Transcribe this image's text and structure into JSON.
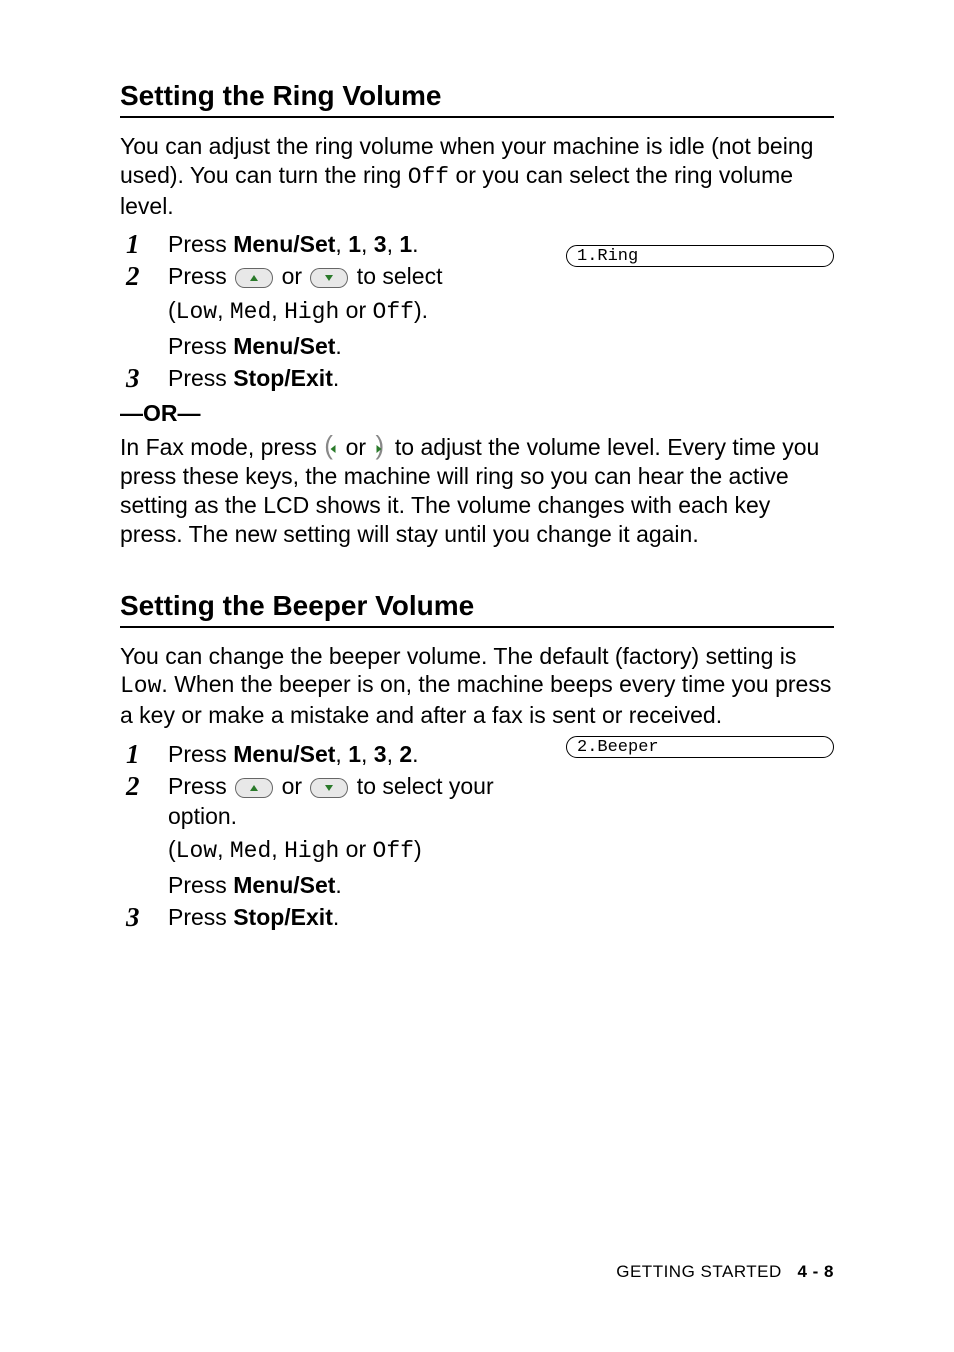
{
  "section1": {
    "title": "Setting the Ring Volume",
    "intro_pre": "You can adjust the ring volume when your machine is idle (not being used). You can turn the ring ",
    "intro_mono": "Off",
    "intro_post": " or you can select the ring volume level.",
    "lcd": "1.Ring",
    "steps": {
      "1": {
        "num": "1",
        "pre": "Press ",
        "bold": "Menu/Set",
        "post": ", ",
        "b1": "1",
        "c1": ", ",
        "b2": "3",
        "c2": ", ",
        "b3": "1",
        "end": "."
      },
      "2": {
        "num": "2",
        "pre": "Press ",
        "mid_or": " or ",
        "post": " to select",
        "line2_open": "(",
        "opt1": "Low",
        "sep1": ", ",
        "opt2": "Med",
        "sep2": ", ",
        "opt3": "High",
        "sep_or": " or ",
        "opt4": "Off",
        "line2_close": ").",
        "line3_pre": "Press ",
        "line3_bold": "Menu/Set",
        "line3_end": "."
      },
      "3": {
        "num": "3",
        "pre": "Press ",
        "bold": "Stop/Exit",
        "end": "."
      }
    },
    "or_line": "—OR—",
    "followup_pre": "In Fax mode, press ",
    "followup_mid_or": " or ",
    "followup_post": " to adjust the volume level. Every time you press these keys, the machine will ring so you can hear the active setting as the LCD shows it. The volume changes with each key press. The new setting will stay until you change it again."
  },
  "section2": {
    "title": "Setting the Beeper Volume",
    "intro_pre": "You can change the beeper volume. The default (factory) setting is ",
    "intro_mono": "Low",
    "intro_post": ". When the beeper is on, the machine beeps every time you press a key or make a mistake and after a fax is sent or received.",
    "lcd": "2.Beeper",
    "steps": {
      "1": {
        "num": "1",
        "pre": "Press ",
        "bold": "Menu/Set",
        "post": ", ",
        "b1": "1",
        "c1": ", ",
        "b2": "3",
        "c2": ", ",
        "b3": "2",
        "end": "."
      },
      "2": {
        "num": "2",
        "pre": "Press ",
        "mid_or": " or ",
        "post": " to select your option.",
        "line2_open": "(",
        "opt1": "Low",
        "sep1": ", ",
        "opt2": "Med",
        "sep2": ", ",
        "opt3": "High",
        "sep_or": " or ",
        "opt4": "Off",
        "line2_close": ")",
        "line3_pre": "Press ",
        "line3_bold": "Menu/Set",
        "line3_end": "."
      },
      "3": {
        "num": "3",
        "pre": "Press ",
        "bold": "Stop/Exit",
        "end": "."
      }
    }
  },
  "footer": {
    "section": "GETTING STARTED",
    "page": "4 - 8"
  }
}
